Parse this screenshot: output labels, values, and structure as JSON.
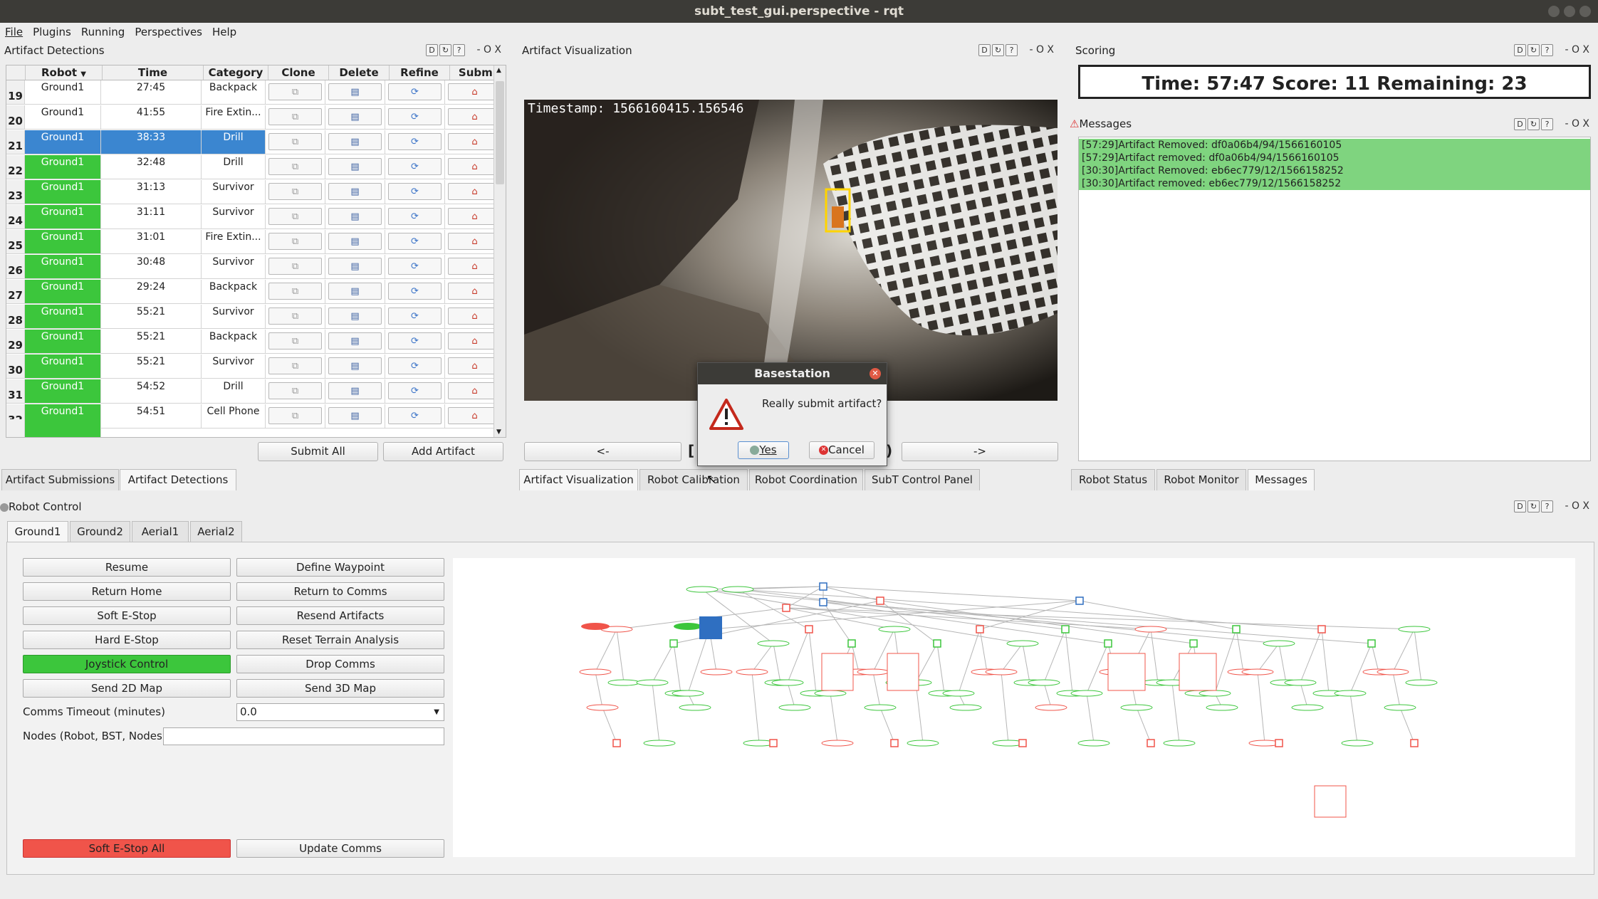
{
  "window": {
    "title": "subt_test_gui.perspective - rqt"
  },
  "menu": [
    "File",
    "Plugins",
    "Running",
    "Perspectives",
    "Help"
  ],
  "artifact_detections": {
    "title": "Artifact Detections",
    "dock_controls": "- O X",
    "columns": [
      "Robot",
      "Time",
      "Category",
      "Clone",
      "Delete",
      "Refine",
      "Submit"
    ],
    "rows": [
      {
        "idx": "19",
        "robot": "Ground1",
        "time": "27:45",
        "category": "Backpack",
        "state": "none"
      },
      {
        "idx": "20",
        "robot": "Ground1",
        "time": "41:55",
        "category": "Fire Extin...",
        "state": "none"
      },
      {
        "idx": "21",
        "robot": "Ground1",
        "time": "38:33",
        "category": "Drill",
        "state": "selected"
      },
      {
        "idx": "22",
        "robot": "Ground1",
        "time": "32:48",
        "category": "Drill",
        "state": "green"
      },
      {
        "idx": "23",
        "robot": "Ground1",
        "time": "31:13",
        "category": "Survivor",
        "state": "green"
      },
      {
        "idx": "24",
        "robot": "Ground1",
        "time": "31:11",
        "category": "Survivor",
        "state": "green"
      },
      {
        "idx": "25",
        "robot": "Ground1",
        "time": "31:01",
        "category": "Fire Extin...",
        "state": "green"
      },
      {
        "idx": "26",
        "robot": "Ground1",
        "time": "30:48",
        "category": "Survivor",
        "state": "green"
      },
      {
        "idx": "27",
        "robot": "Ground1",
        "time": "29:24",
        "category": "Backpack",
        "state": "green"
      },
      {
        "idx": "28",
        "robot": "Ground1",
        "time": "55:21",
        "category": "Survivor",
        "state": "green"
      },
      {
        "idx": "29",
        "robot": "Ground1",
        "time": "55:21",
        "category": "Backpack",
        "state": "green"
      },
      {
        "idx": "30",
        "robot": "Ground1",
        "time": "55:21",
        "category": "Survivor",
        "state": "green"
      },
      {
        "idx": "31",
        "robot": "Ground1",
        "time": "54:52",
        "category": "Drill",
        "state": "green"
      },
      {
        "idx": "32",
        "robot": "Ground1",
        "time": "54:51",
        "category": "Cell Phone",
        "state": "green"
      }
    ],
    "submit_all": "Submit All",
    "add_artifact": "Add Artifact"
  },
  "left_tabs": [
    "Artifact Submissions",
    "Artifact Detections"
  ],
  "viz": {
    "title": "Artifact Visualization",
    "timestamp": "Timestamp: 1566160415.156546",
    "prev": "<-",
    "next": "->",
    "counter_left": "[",
    "counter_right": ")"
  },
  "center_tabs": [
    "Artifact Visualization",
    "Robot Calibration",
    "Robot Coordination",
    "SubT Control Panel"
  ],
  "scoring": {
    "title": "Scoring",
    "score_text": "Time: 57:47  Score: 11  Remaining: 23",
    "messages_title": "Messages",
    "messages": [
      "[57:29]Artifact Removed: df0a06b4/94/1566160105",
      "[57:29]Artifact removed: df0a06b4/94/1566160105",
      "[30:30]Artifact Removed: eb6ec779/12/1566158252",
      "[30:30]Artifact removed: eb6ec779/12/1566158252"
    ]
  },
  "right_tabs": [
    "Robot Status",
    "Robot Monitor",
    "Messages"
  ],
  "robot_control": {
    "title": "Robot Control",
    "tabs": [
      "Ground1",
      "Ground2",
      "Aerial1",
      "Aerial2"
    ],
    "left_buttons": [
      "Resume",
      "Return Home",
      "Soft E-Stop",
      "Hard E-Stop",
      "Joystick Control",
      "Send 2D Map"
    ],
    "right_buttons": [
      "Define Waypoint",
      "Return to Comms",
      "Resend Artifacts",
      "Reset Terrain Analysis",
      "Drop Comms",
      "Send 3D Map"
    ],
    "comms_timeout_label": "Comms Timeout (minutes)",
    "comms_timeout_value": "0.0",
    "nodes_label": "Nodes (Robot, BST, Nodes)",
    "soft_estop_all": "Soft E-Stop All",
    "update_comms": "Update Comms",
    "colors": {
      "green": "#3cc63c",
      "red": "#f0544a",
      "blue": "#2f6fc1"
    }
  },
  "dialog": {
    "title": "Basestation",
    "message": "Really submit artifact?",
    "yes": "Yes",
    "cancel": "Cancel"
  }
}
